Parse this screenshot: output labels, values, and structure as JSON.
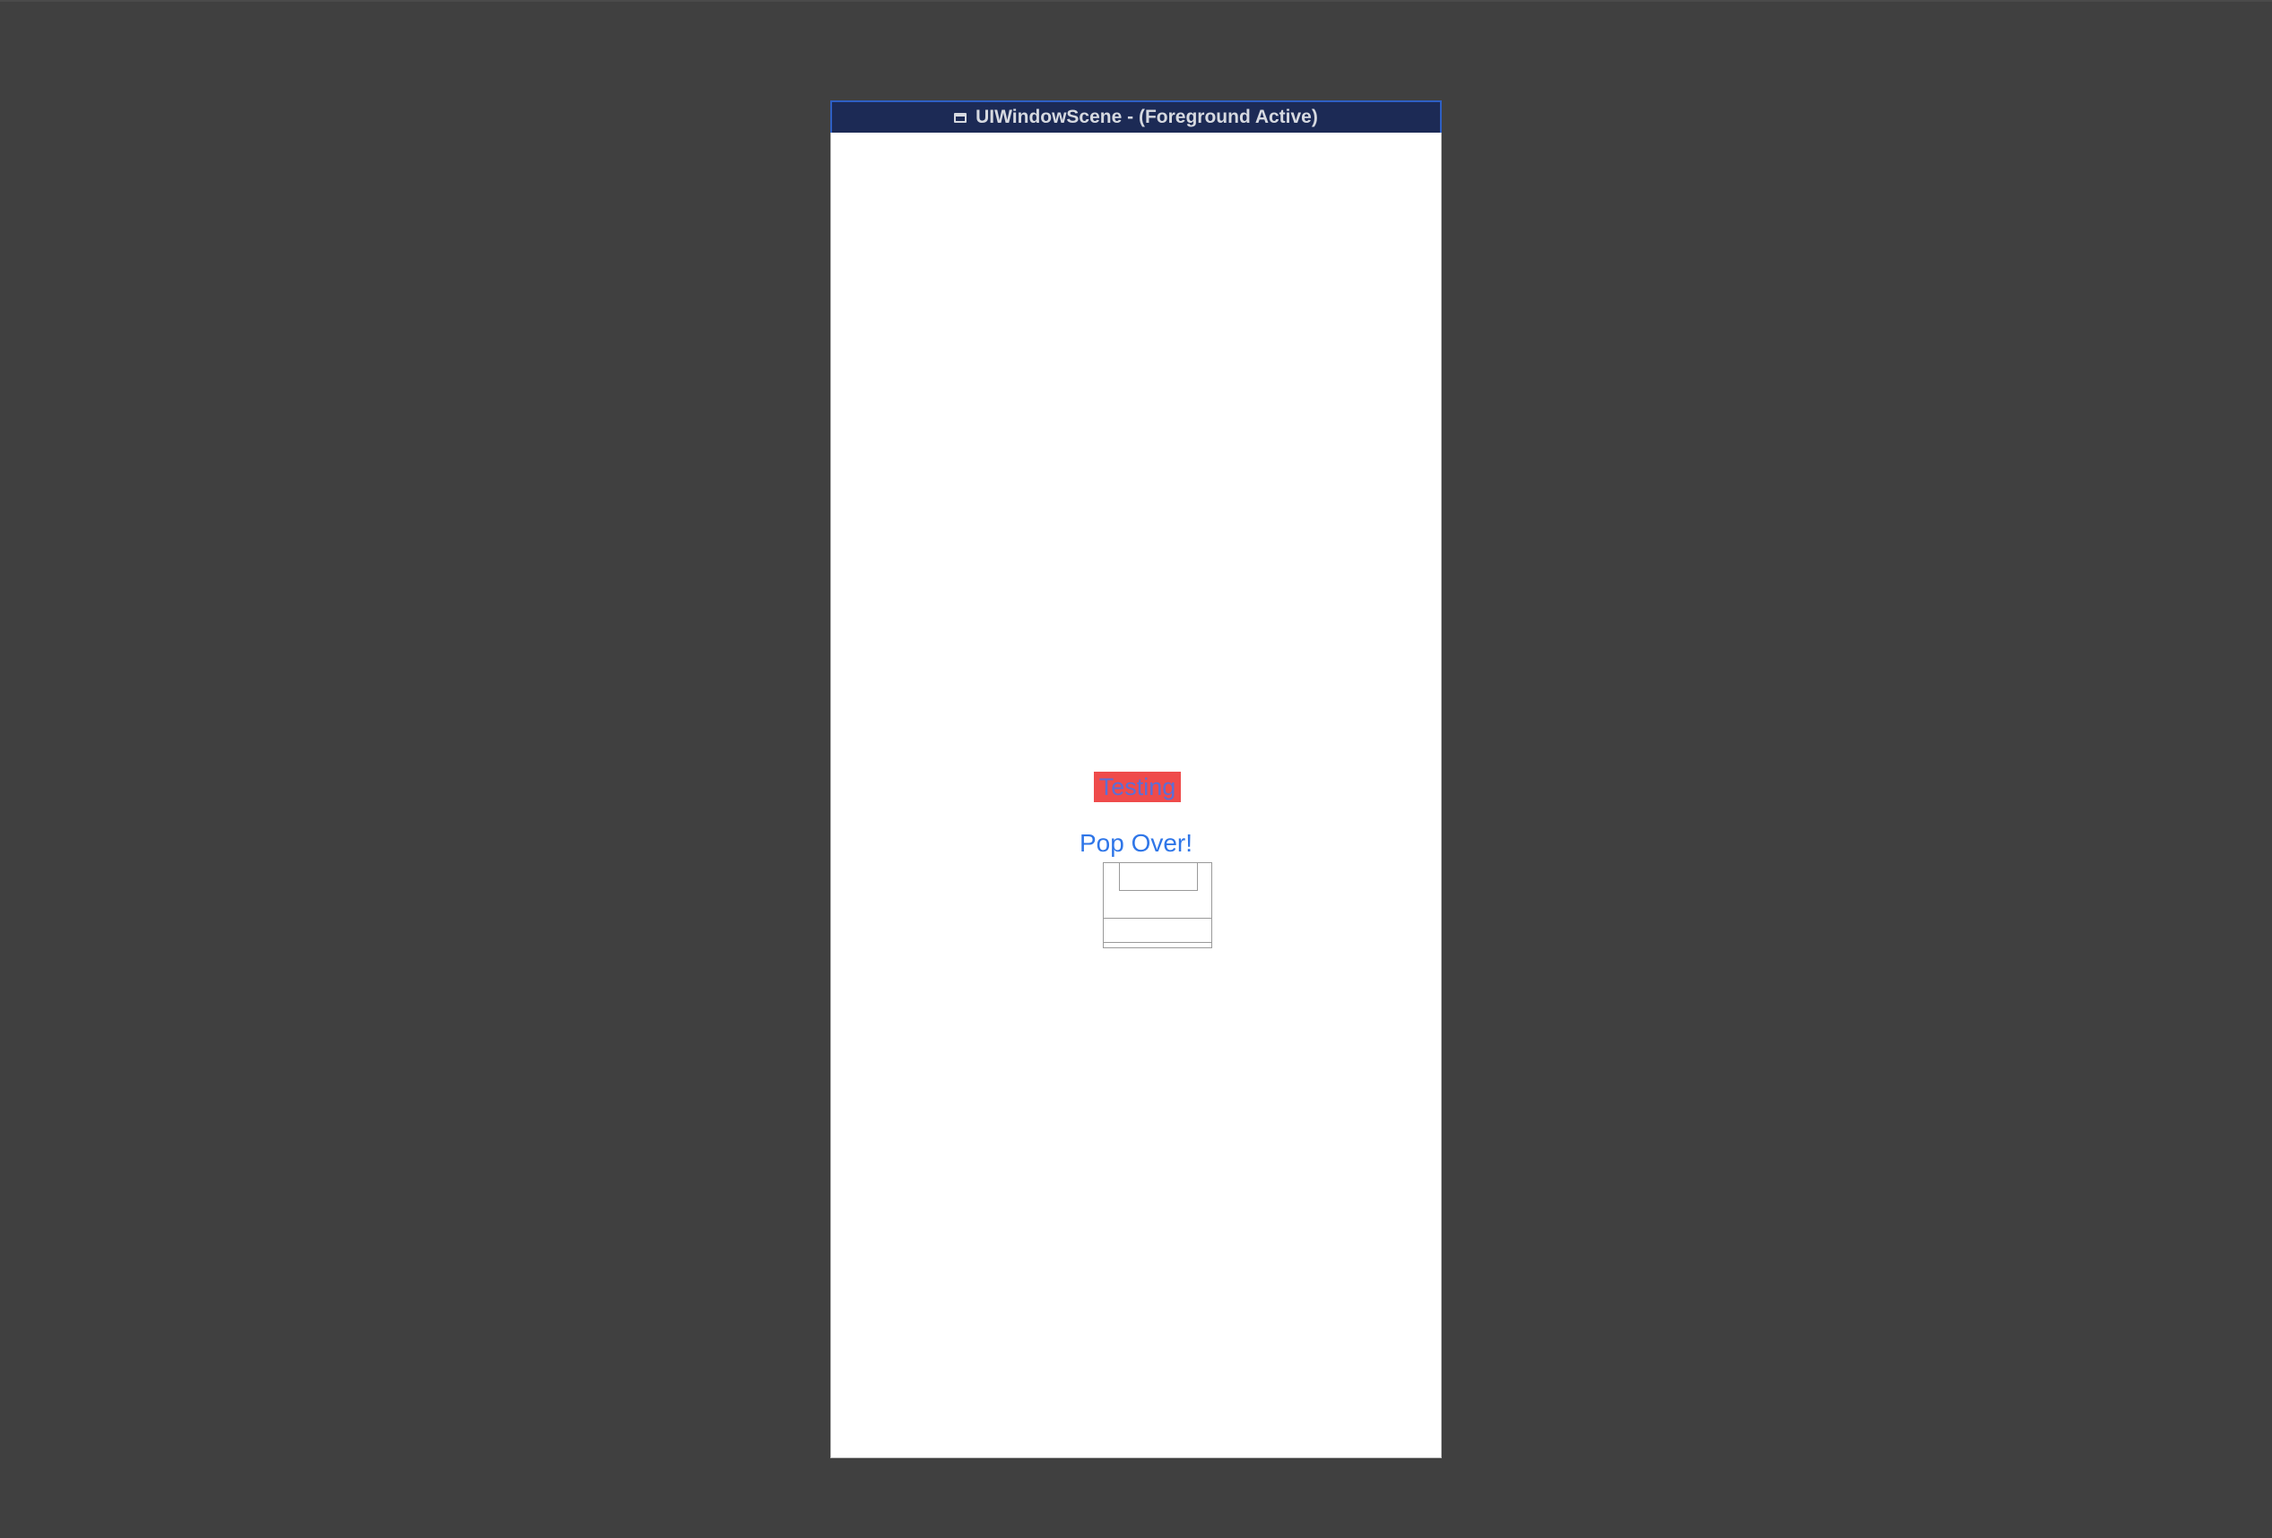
{
  "scene": {
    "title": "UIWindowScene - (Foreground Active)",
    "title_icon": "window-icon"
  },
  "content": {
    "label_text": "Testing",
    "button_label": "Pop Over!"
  },
  "colors": {
    "canvas_background": "#404040",
    "titlebar_background": "#1c2a55",
    "titlebar_border": "#2e5fc4",
    "label_background": "#ef4b4b",
    "label_text": "#5a6fd8",
    "button_tint": "#2f76e8",
    "wireframe_stroke": "#9a9a9a"
  }
}
